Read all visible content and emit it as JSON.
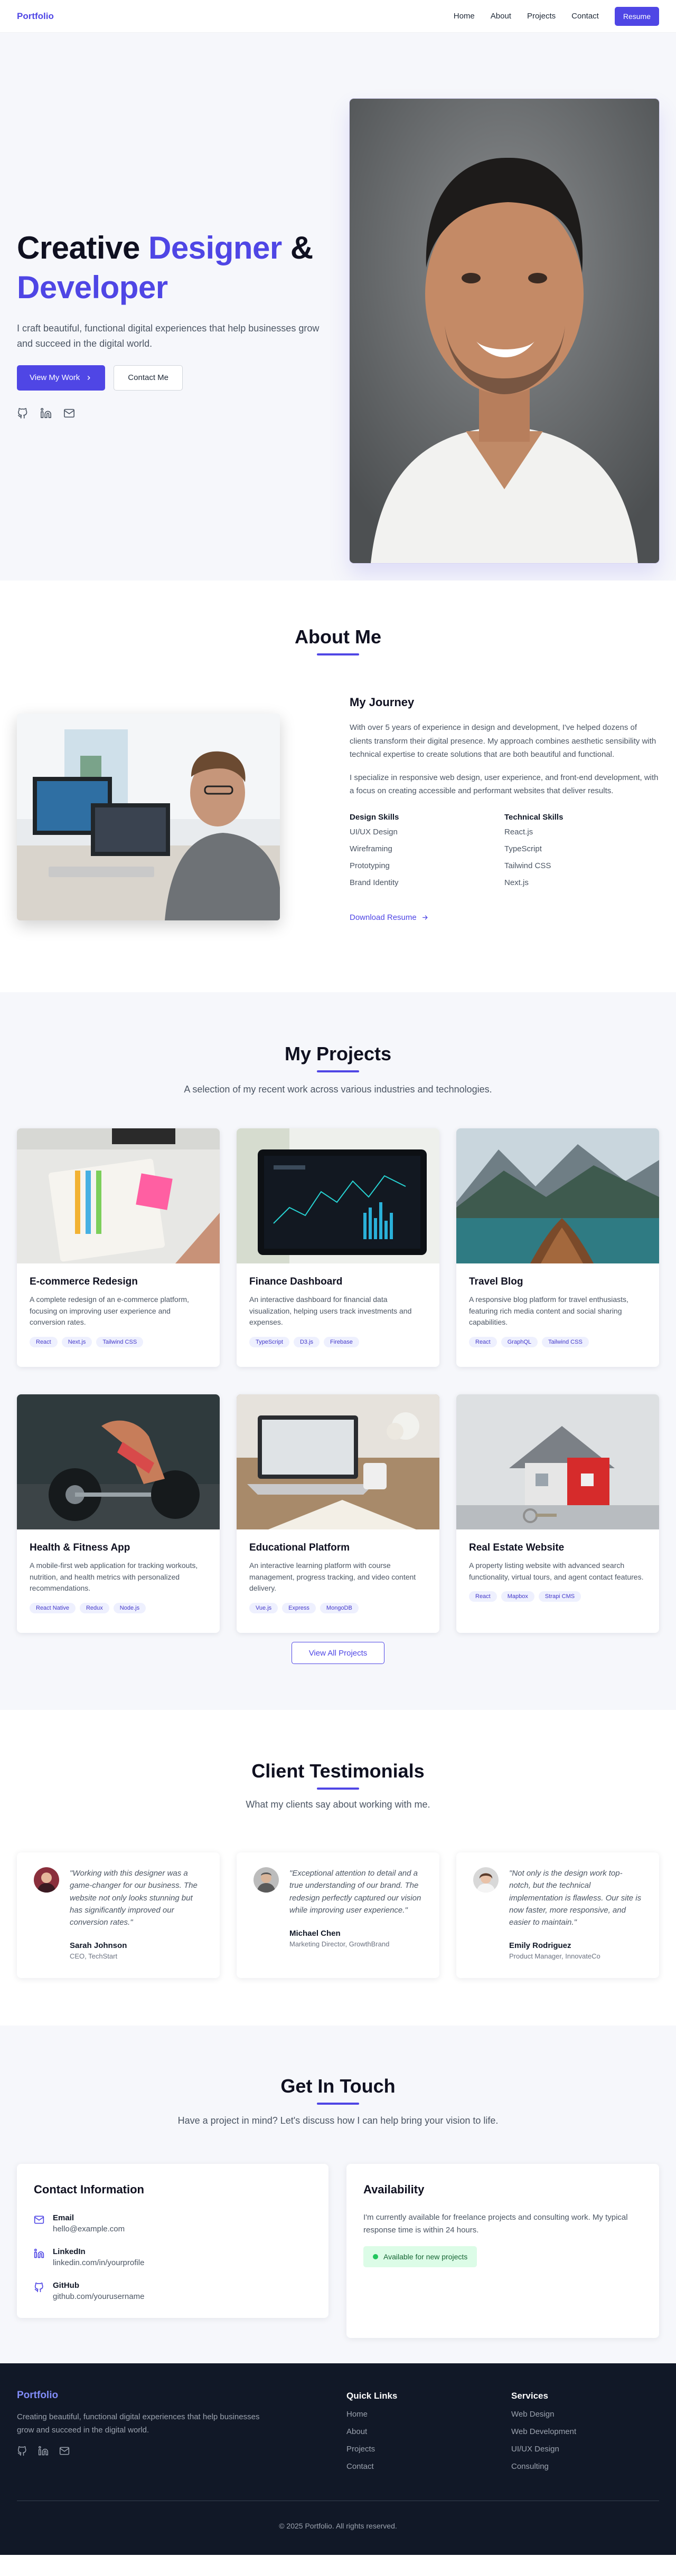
{
  "nav": {
    "brand": "Portfolio",
    "links": [
      "Home",
      "About",
      "Projects",
      "Contact"
    ],
    "resume": "Resume"
  },
  "hero": {
    "title_1": "Creative ",
    "title_accent_1": "Designer",
    "title_2": " &",
    "title_accent_2": "Developer",
    "description": "I craft beautiful, functional digital experiences that help businesses grow and succeed in the digital world.",
    "primary_button": "View My Work",
    "secondary_button": "Contact Me",
    "social_icons": [
      "github-icon",
      "linkedin-icon",
      "mail-icon"
    ]
  },
  "about": {
    "title": "About Me",
    "heading": "My Journey",
    "paragraph_1": "With over 5 years of experience in design and development, I've helped dozens of clients transform their digital presence. My approach combines aesthetic sensibility with technical expertise to create solutions that are both beautiful and functional.",
    "paragraph_2": "I specialize in responsive web design, user experience, and front-end development, with a focus on creating accessible and performant websites that deliver results.",
    "design_skills_title": "Design Skills",
    "design_skills": [
      "UI/UX Design",
      "Wireframing",
      "Prototyping",
      "Brand Identity"
    ],
    "technical_skills_title": "Technical Skills",
    "technical_skills": [
      "React.js",
      "TypeScript",
      "Tailwind CSS",
      "Next.js"
    ],
    "download": "Download Resume"
  },
  "projects": {
    "title": "My Projects",
    "subtitle": "A selection of my recent work across various industries and technologies.",
    "items": [
      {
        "title": "E-commerce Redesign",
        "description": "A complete redesign of an e-commerce platform, focusing on improving user experience and conversion rates.",
        "tags": [
          "React",
          "Next.js",
          "Tailwind CSS"
        ]
      },
      {
        "title": "Finance Dashboard",
        "description": "An interactive dashboard for financial data visualization, helping users track investments and expenses.",
        "tags": [
          "TypeScript",
          "D3.js",
          "Firebase"
        ]
      },
      {
        "title": "Travel Blog",
        "description": "A responsive blog platform for travel enthusiasts, featuring rich media content and social sharing capabilities.",
        "tags": [
          "React",
          "GraphQL",
          "Tailwind CSS"
        ]
      },
      {
        "title": "Health & Fitness App",
        "description": "A mobile-first web application for tracking workouts, nutrition, and health metrics with personalized recommendations.",
        "tags": [
          "React Native",
          "Redux",
          "Node.js"
        ]
      },
      {
        "title": "Educational Platform",
        "description": "An interactive learning platform with course management, progress tracking, and video content delivery.",
        "tags": [
          "Vue.js",
          "Express",
          "MongoDB"
        ]
      },
      {
        "title": "Real Estate Website",
        "description": "A property listing website with advanced search functionality, virtual tours, and agent contact features.",
        "tags": [
          "React",
          "Mapbox",
          "Strapi CMS"
        ]
      }
    ],
    "view_all": "View All Projects"
  },
  "testimonials": {
    "title": "Client Testimonials",
    "subtitle": "What my clients say about working with me.",
    "items": [
      {
        "quote": "\"Working with this designer was a game-changer for our business. The website not only looks stunning but has significantly improved our conversion rates.\"",
        "name": "Sarah Johnson",
        "role": "CEO, TechStart"
      },
      {
        "quote": "\"Exceptional attention to detail and a true understanding of our brand. The redesign perfectly captured our vision while improving user experience.\"",
        "name": "Michael Chen",
        "role": "Marketing Director, GrowthBrand"
      },
      {
        "quote": "\"Not only is the design work top-notch, but the technical implementation is flawless. Our site is now faster, more responsive, and easier to maintain.\"",
        "name": "Emily Rodriguez",
        "role": "Product Manager, InnovateCo"
      }
    ]
  },
  "contact": {
    "title": "Get In Touch",
    "subtitle": "Have a project in mind? Let's discuss how I can help bring your vision to life.",
    "info_title": "Contact Information",
    "items": [
      {
        "label": "Email",
        "value": "hello@example.com",
        "icon": "mail-icon"
      },
      {
        "label": "LinkedIn",
        "value": "linkedin.com/in/yourprofile",
        "icon": "linkedin-icon"
      },
      {
        "label": "GitHub",
        "value": "github.com/yourusername",
        "icon": "github-icon"
      }
    ],
    "availability_title": "Availability",
    "availability_text": "I'm currently available for freelance projects and consulting work. My typical response time is within 24 hours.",
    "availability_badge": "Available for new projects"
  },
  "footer": {
    "brand": "Portfolio",
    "description": "Creating beautiful, functional digital experiences that help businesses grow and succeed in the digital world.",
    "quick_links_title": "Quick Links",
    "quick_links": [
      "Home",
      "About",
      "Projects",
      "Contact"
    ],
    "services_title": "Services",
    "services": [
      "Web Design",
      "Web Development",
      "UI/UX Design",
      "Consulting"
    ],
    "copyright": "© 2025 Portfolio. All rights reserved."
  },
  "colors": {
    "accent": "#4f46e5",
    "footer_bg": "#111827",
    "section_bg": "#f6f7fb",
    "available_green": "#22c55e"
  }
}
